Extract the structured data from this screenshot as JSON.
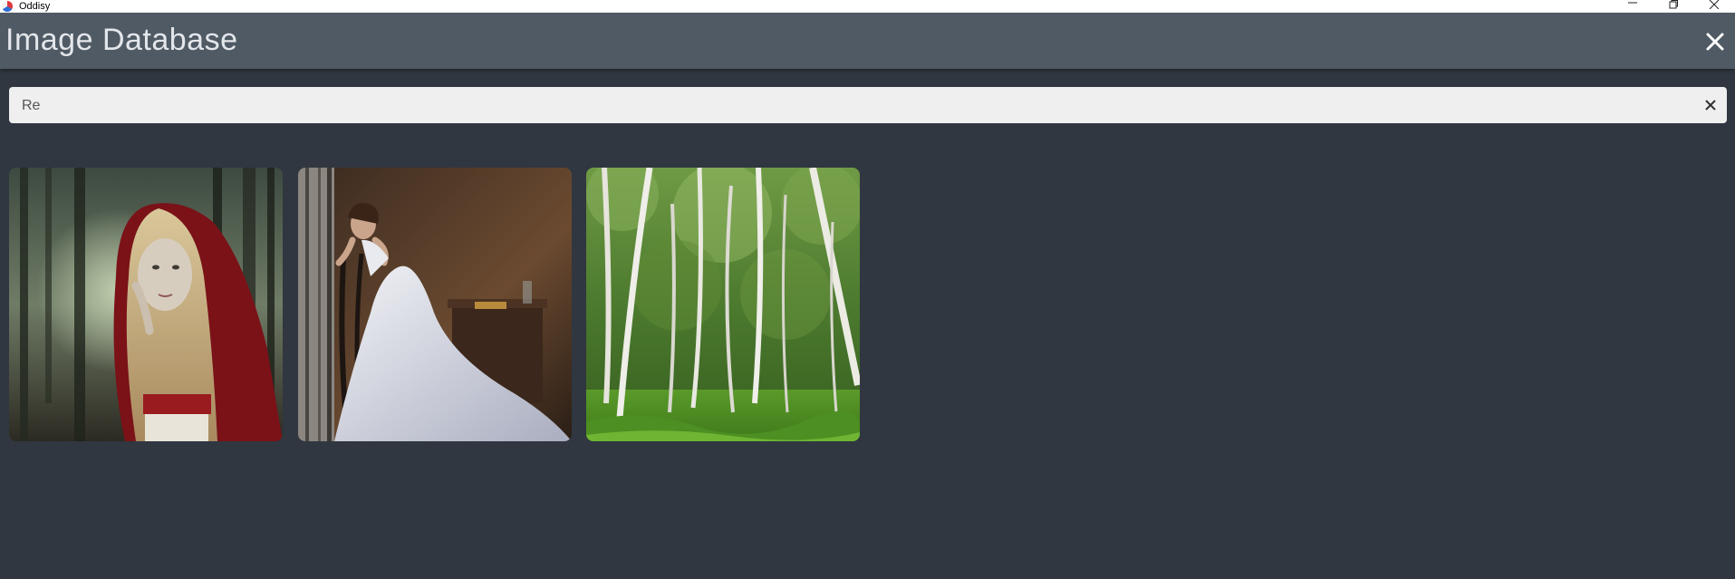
{
  "window": {
    "app_name": "Oddisy"
  },
  "header": {
    "title": "Image Database"
  },
  "search": {
    "value": "Re",
    "placeholder": ""
  },
  "gallery": {
    "images": [
      {
        "name": "girl-in-red-hood-forest"
      },
      {
        "name": "woman-white-dress-chair"
      },
      {
        "name": "birch-forest"
      }
    ]
  },
  "colors": {
    "background": "#303740",
    "header": "#4f5a64",
    "search_bg": "#efefef",
    "title_text": "#e3e6ea"
  }
}
